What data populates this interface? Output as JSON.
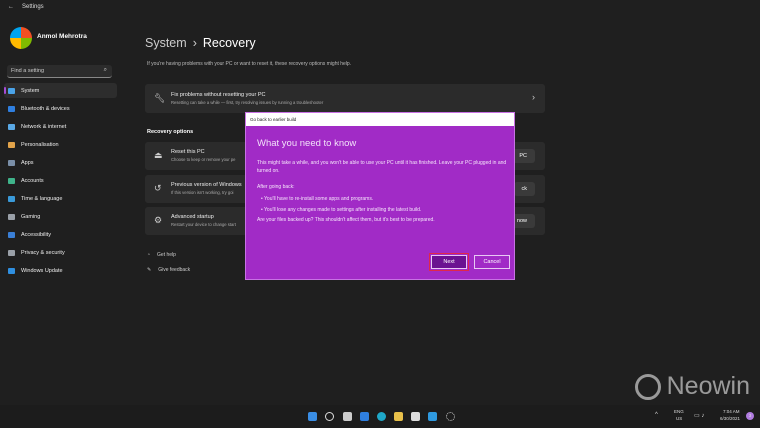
{
  "window": {
    "back": "←",
    "title": "Settings"
  },
  "user": {
    "name": "Anmol Mehrotra"
  },
  "search": {
    "placeholder": "Find a setting"
  },
  "sidebar": {
    "items": [
      {
        "label": "System",
        "color": "#4aa3e8"
      },
      {
        "label": "Bluetooth & devices",
        "color": "#2f7fe0"
      },
      {
        "label": "Network & internet",
        "color": "#5aa9e6"
      },
      {
        "label": "Personalisation",
        "color": "#e2a34a"
      },
      {
        "label": "Apps",
        "color": "#7a8fa8"
      },
      {
        "label": "Accounts",
        "color": "#3fb38a"
      },
      {
        "label": "Time & language",
        "color": "#3a9ad9"
      },
      {
        "label": "Gaming",
        "color": "#9aa0a8"
      },
      {
        "label": "Accessibility",
        "color": "#3a7fd6"
      },
      {
        "label": "Privacy & security",
        "color": "#9aa0a8"
      },
      {
        "label": "Windows Update",
        "color": "#2f8fe0"
      }
    ]
  },
  "header": {
    "parent": "System",
    "sep": "›",
    "title": "Recovery"
  },
  "description": "If you're having problems with your PC or want to reset it, these recovery options might help.",
  "fix_card": {
    "title": "Fix problems without resetting your PC",
    "subtitle": "Resetting can take a while — first, try resolving issues by running a troubleshooter",
    "chevron": "›"
  },
  "recovery_options": {
    "heading": "Recovery options",
    "items": [
      {
        "title": "Reset this PC",
        "subtitle": "Choose to keep or remove your pe",
        "button": "PC"
      },
      {
        "title": "Previous version of Windows",
        "subtitle": "If this version isn't working, try goi",
        "button": "ck"
      },
      {
        "title": "Advanced startup",
        "subtitle": "Restart your device to change start",
        "button": "now"
      }
    ]
  },
  "links": [
    {
      "label": "Get help"
    },
    {
      "label": "Give feedback"
    }
  ],
  "dialog": {
    "title": "Go back to earlier build",
    "heading": "What you need to know",
    "p1": "This might take a while, and you won't be able to use your PC until it has finished. Leave your PC plugged in and turned on.",
    "p2": "After going back:",
    "b1": "• You'll have to re-install some apps and programs.",
    "b2": "• You'll lose any changes made to settings after installing the latest build.",
    "p3": "Are your files backed up? This shouldn't affect them, but it's best to be prepared.",
    "next": "Next",
    "cancel": "Cancel"
  },
  "taskbar": {
    "lang1": "ENG",
    "lang2": "US",
    "time": "7:04 AM",
    "date": "6/30/2021",
    "badge": "3"
  },
  "watermark": "Neowin"
}
